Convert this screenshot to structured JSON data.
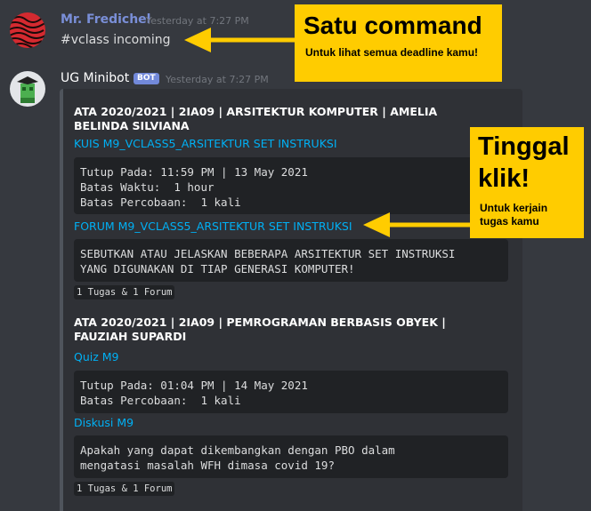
{
  "messages": [
    {
      "username": "Mr. Fredichel",
      "timestamp": "Yesterday at 7:27 PM",
      "text": "#vclass incoming"
    },
    {
      "username": "UG Minibot",
      "badge": "BOT",
      "timestamp": "Yesterday at 7:27 PM"
    }
  ],
  "embed": {
    "section1": {
      "title": "ATA 2020/2021 | 2IA09 | ARSITEKTUR KOMPUTER | AMELIA BELINDA SILVIANA",
      "quiz_link": "KUIS M9_VCLASS5_ARSITEKTUR SET INSTRUKSI",
      "quiz_details": "Tutup Pada: 11:59 PM | 13 May 2021\nBatas Waktu:  1 hour\nBatas Percobaan:  1 kali",
      "forum_link": "FORUM M9_VCLASS5_ARSITEKTUR SET INSTRUKSI",
      "forum_details": "SEBUTKAN ATAU JELASKAN BEBERAPA ARSITEKTUR SET INSTRUKSI\nYANG DIGUNAKAN DI TIAP GENERASI KOMPUTER!",
      "summary": "1 Tugas & 1 Forum"
    },
    "section2": {
      "title": "ATA 2020/2021 | 2IA09 | PEMROGRAMAN BERBASIS OBYEK | FAUZIAH SUPARDI",
      "quiz_link": "Quiz M9",
      "quiz_details": "Tutup Pada: 01:04 PM | 14 May 2021\nBatas Percobaan:  1 kali",
      "forum_link": "Diskusi M9",
      "forum_details": "Apakah yang dapat dikembangkan dengan PBO dalam\nmengatasi masalah WFH dimasa covid 19?",
      "summary": "1 Tugas & 1 Forum"
    }
  },
  "callouts": {
    "top": {
      "heading": "Satu command",
      "subtext": "Untuk lihat semua deadline kamu!"
    },
    "right": {
      "heading_line1": "Tinggal",
      "heading_line2": "klik!",
      "subtext": "Untuk kerjain tugas kamu"
    }
  },
  "colors": {
    "background": "#36393f",
    "link": "#00b0f4",
    "callout": "#ffcc00",
    "bot_badge": "#7289da"
  }
}
